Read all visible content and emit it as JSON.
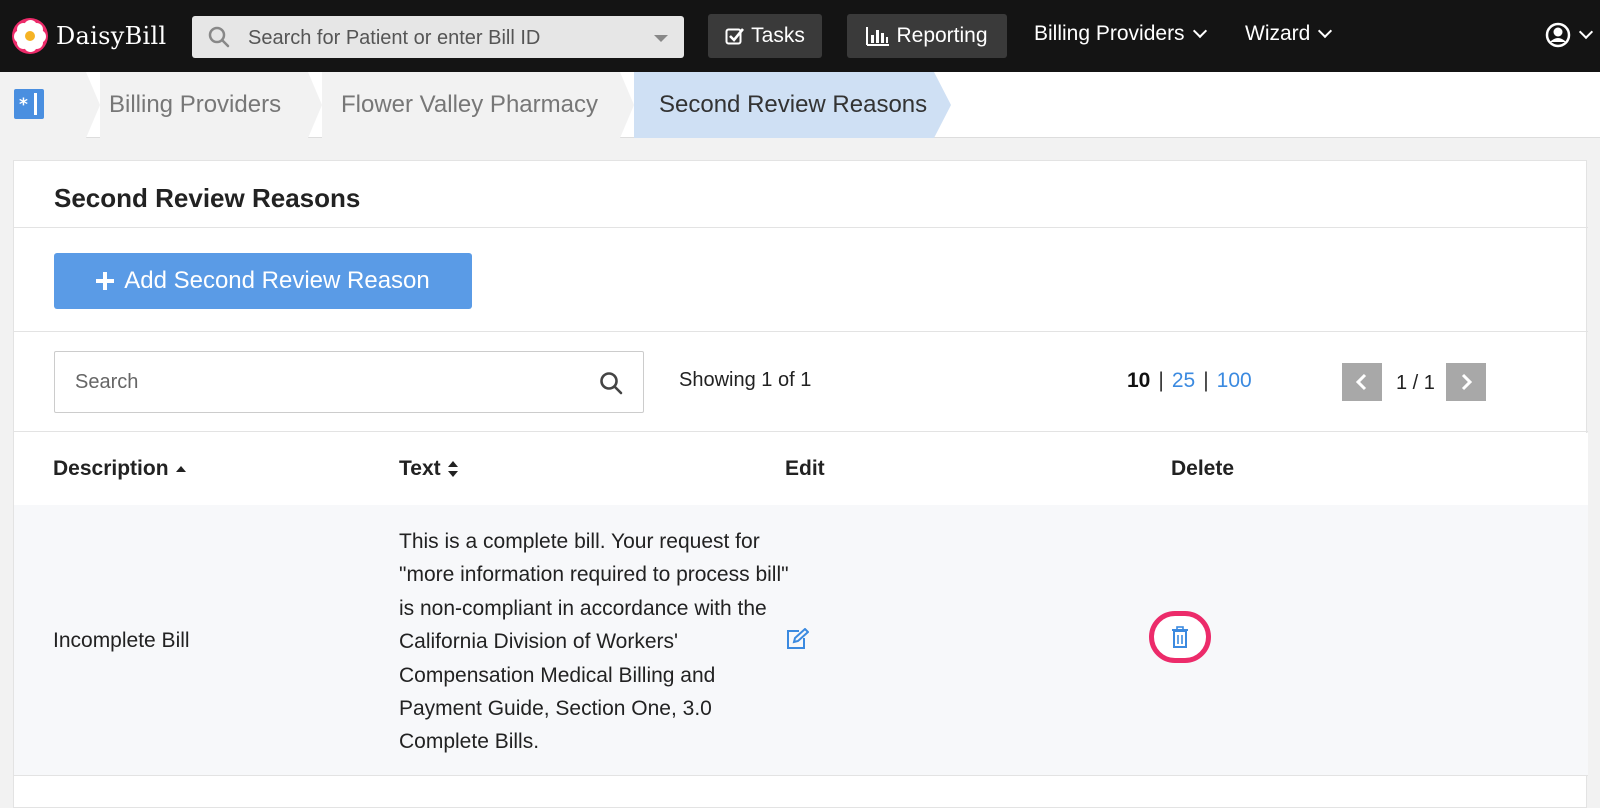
{
  "app": {
    "logo_text": "DaisyBill"
  },
  "topnav": {
    "search_placeholder": "Search for Patient or enter Bill ID",
    "tasks_label": "Tasks",
    "reporting_label": "Reporting",
    "billing_providers_label": "Billing Providers",
    "wizard_label": "Wizard"
  },
  "breadcrumb": {
    "items": [
      "Billing Providers",
      "Flower Valley Pharmacy",
      "Second Review Reasons"
    ]
  },
  "page": {
    "title": "Second Review Reasons",
    "add_button_label": "Add Second Review Reason",
    "search_placeholder": "Search",
    "showing": "Showing 1 of 1",
    "page_sizes": [
      "10",
      "25",
      "100"
    ],
    "page_indicator": "1 / 1"
  },
  "table": {
    "headers": {
      "description": "Description",
      "text": "Text",
      "edit": "Edit",
      "delete": "Delete"
    },
    "rows": [
      {
        "description": "Incomplete Bill",
        "text": "This is a complete bill. Your request for \"more information required to process bill\" is non-compliant in accordance with the California Division of Workers' Compensation Medical Billing and Payment Guide, Section One, 3.0 Complete Bills."
      }
    ]
  },
  "colors": {
    "accent": "#5a9be6",
    "highlight": "#ec2b6a",
    "nav_bg": "#141414",
    "active_crumb": "#cfe0f4"
  }
}
